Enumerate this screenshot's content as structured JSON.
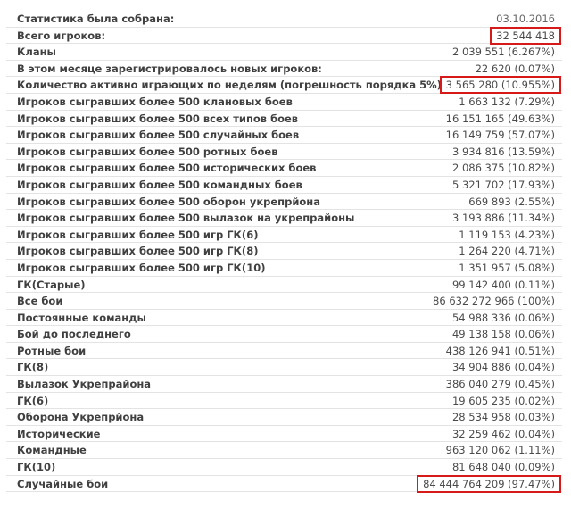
{
  "stats": {
    "rows": [
      {
        "label": "Статистика была собрана:",
        "value": "03.10.2016"
      },
      {
        "label": "Всего игроков:",
        "value": "32 544 418"
      },
      {
        "label": "Кланы",
        "value": "2 039 551 (6.267%)"
      },
      {
        "label": "В этом месяце зарегистрировалось новых игроков:",
        "value": "22 620 (0.07%)"
      },
      {
        "label": "Количество активно играющих по неделям (погрешность порядка 5%)",
        "value": "3 565 280 (10.955%)"
      },
      {
        "label": "Игроков сыгравших более 500 клановых боев",
        "value": "1 663 132 (7.29%)"
      },
      {
        "label": "Игроков сыгравших более 500 всех типов боев",
        "value": "16 151 165 (49.63%)"
      },
      {
        "label": "Игроков сыгравших более 500 случайных боев",
        "value": "16 149 759 (57.07%)"
      },
      {
        "label": "Игроков сыгравших более 500 ротных боев",
        "value": "3 934 816 (13.59%)"
      },
      {
        "label": "Игроков сыгравших более 500 исторических боев",
        "value": "2 086 375 (10.82%)"
      },
      {
        "label": "Игроков сыгравших более 500 командных боев",
        "value": "5 321 702 (17.93%)"
      },
      {
        "label": "Игроков сыгравших более 500 оборон укрепрйона",
        "value": "669 893 (2.55%)"
      },
      {
        "label": "Игроков сыгравших более 500 вылазок на укрепрайоны",
        "value": "3 193 886 (11.34%)"
      },
      {
        "label": "Игроков сыгравших более 500 игр ГК(6)",
        "value": "1 119 153 (4.23%)"
      },
      {
        "label": "Игроков сыгравших более 500 игр ГК(8)",
        "value": "1 264 220 (4.71%)"
      },
      {
        "label": "Игроков сыгравших более 500 игр ГК(10)",
        "value": "1 351 957 (5.08%)"
      },
      {
        "label": "ГК(Старые)",
        "value": "99 142 400 (0.11%)"
      },
      {
        "label": "Все бои",
        "value": "86 632 272 966 (100%)"
      },
      {
        "label": "Постоянные команды",
        "value": "54 988 336 (0.06%)"
      },
      {
        "label": "Бой до последнего",
        "value": "49 138 158 (0.06%)"
      },
      {
        "label": "Ротные бои",
        "value": "438 126 941 (0.51%)"
      },
      {
        "label": "ГК(8)",
        "value": "34 904 886 (0.04%)"
      },
      {
        "label": "Вылазок Укрепрайона",
        "value": "386 040 279 (0.45%)"
      },
      {
        "label": "ГК(6)",
        "value": "19 605 235 (0.02%)"
      },
      {
        "label": "Оборона Укрепрйона",
        "value": "28 534 958 (0.03%)"
      },
      {
        "label": "Исторические",
        "value": "32 259 462 (0.04%)"
      },
      {
        "label": "Командные",
        "value": "963 120 062 (1.11%)"
      },
      {
        "label": "ГК(10)",
        "value": "81 648 040 (0.09%)"
      },
      {
        "label": "Случайные бои",
        "value": "84 444 764 209 (97.47%)"
      }
    ]
  },
  "highlight_color": "#d61a1a"
}
